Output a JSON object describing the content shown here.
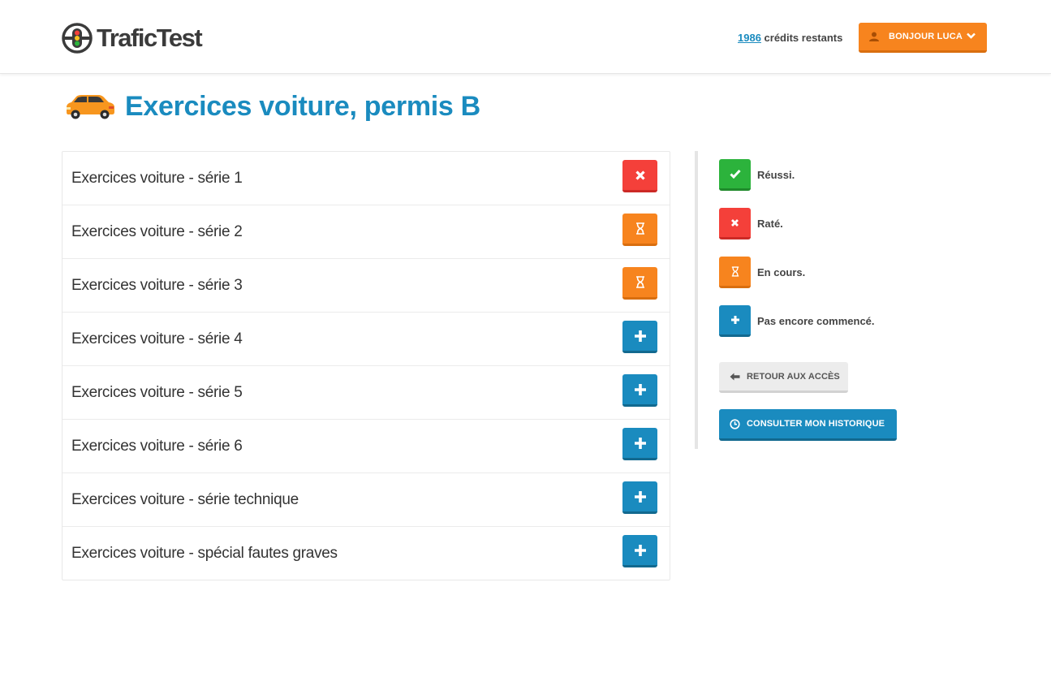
{
  "header": {
    "logo_text": "TraficTest",
    "credits_count": "1986",
    "credits_suffix": " crédits restants",
    "user_button_label": "BONJOUR LUCA"
  },
  "page": {
    "title": "Exercices voiture, permis B"
  },
  "series": [
    {
      "label": "Exercices voiture - série 1",
      "status": "failed"
    },
    {
      "label": "Exercices voiture - série 2",
      "status": "in-progress"
    },
    {
      "label": "Exercices voiture - série 3",
      "status": "in-progress"
    },
    {
      "label": "Exercices voiture - série 4",
      "status": "not-started"
    },
    {
      "label": "Exercices voiture - série 5",
      "status": "not-started"
    },
    {
      "label": "Exercices voiture - série 6",
      "status": "not-started"
    },
    {
      "label": "Exercices voiture - série technique",
      "status": "not-started"
    },
    {
      "label": "Exercices voiture - spécial fautes graves",
      "status": "not-started"
    }
  ],
  "legend": [
    {
      "label": "Réussi.",
      "status": "passed",
      "icon": "check-icon"
    },
    {
      "label": "Raté.",
      "status": "failed",
      "icon": "close-icon"
    },
    {
      "label": "En cours.",
      "status": "in-progress",
      "icon": "hourglass-icon"
    },
    {
      "label": "Pas encore commencé.",
      "status": "not-started",
      "icon": "plus-icon"
    }
  ],
  "actions": {
    "back_label": "RETOUR AUX ACCÈS",
    "history_label": "CONSULTER MON HISTORIQUE"
  },
  "colors": {
    "brand_blue": "#1a8bbf",
    "orange": "#f7841e",
    "red": "#f4403a",
    "green": "#2cb33c"
  }
}
